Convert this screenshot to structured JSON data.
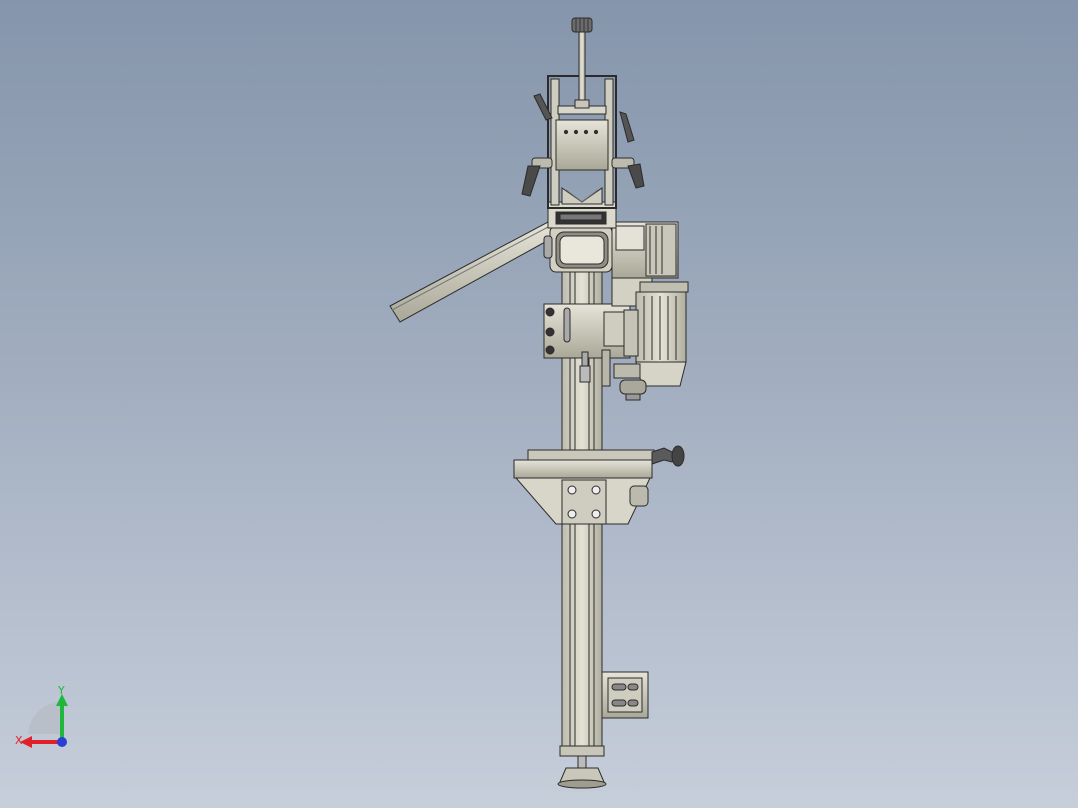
{
  "window": {
    "type": "cad-3d-viewport"
  },
  "model": {
    "parts": [
      "adjust-knob",
      "guide-rail",
      "tensioner-frame",
      "clamp-lever-left",
      "clamp-lever-right",
      "drive-roller",
      "feed-chute",
      "gear-motor",
      "mounting-plate",
      "support-column",
      "table-flange",
      "wall-bracket",
      "leveling-foot"
    ]
  },
  "triad": {
    "x_label": "X",
    "y_label": "Y",
    "x_color": "#e0212a",
    "y_color": "#1fb83c",
    "z_color": "#2a3fd6"
  },
  "colors": {
    "background_top": "#8595ab",
    "background_bottom": "#c6ceda",
    "part_fill": "#d6d4c4",
    "part_stroke": "#2b2b2b"
  }
}
